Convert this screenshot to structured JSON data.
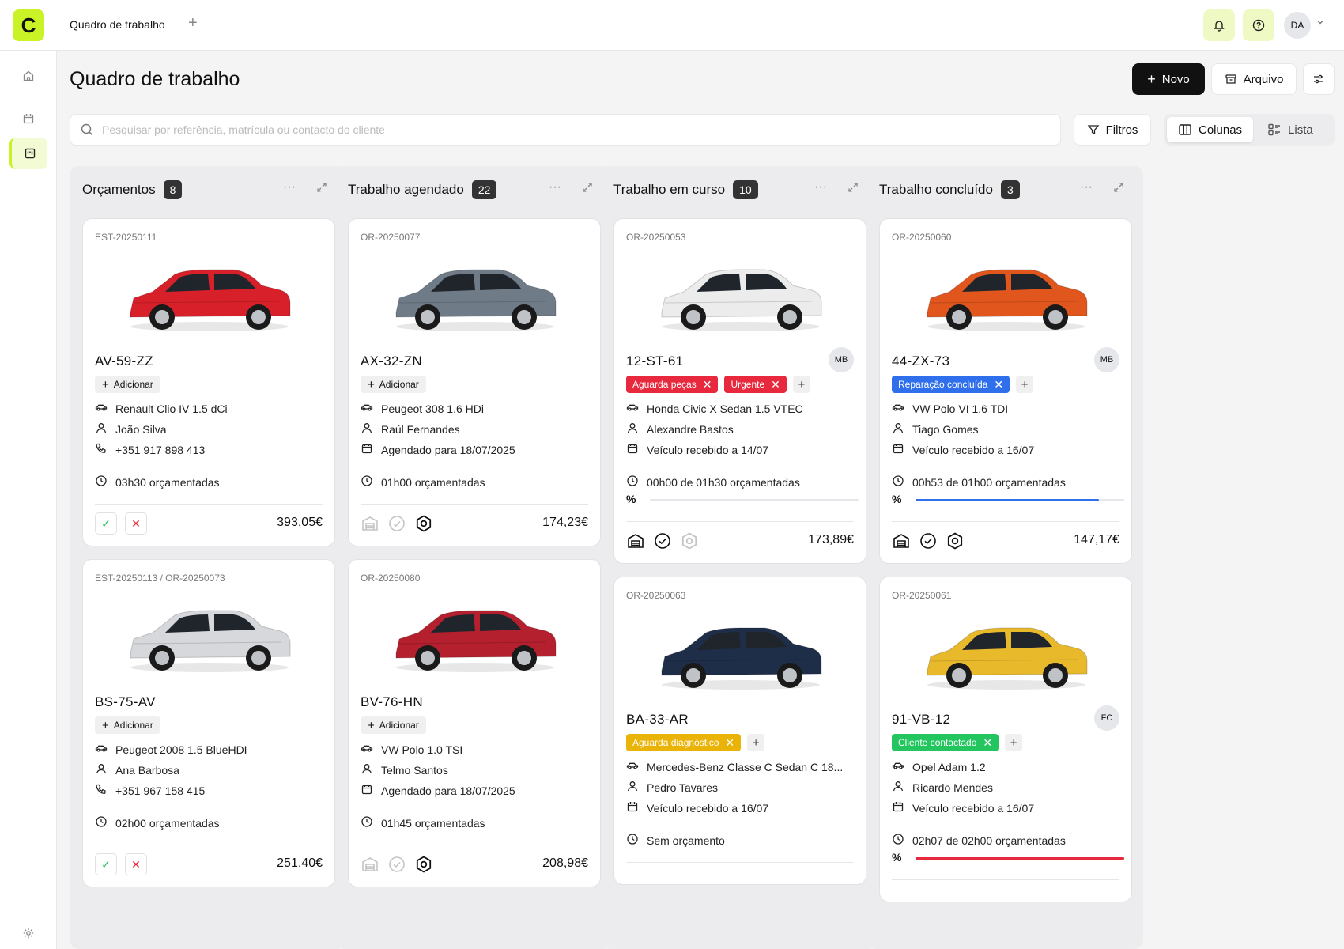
{
  "topbar": {
    "logo_letter": "C",
    "tab_label": "Quadro de trabalho",
    "avatar_initials": "DA"
  },
  "page": {
    "title": "Quadro de trabalho"
  },
  "actions": {
    "new_label": "Novo",
    "archive_label": "Arquivo"
  },
  "search": {
    "placeholder": "Pesquisar por referência, matrícula ou contacto do cliente"
  },
  "filters_label": "Filtros",
  "view": {
    "columns_label": "Colunas",
    "list_label": "Lista",
    "selected": "Colunas"
  },
  "add_label": "Adicionar",
  "columns": [
    {
      "title": "Orçamentos",
      "count": "8",
      "cards": [
        {
          "ref": "EST-20250111",
          "plate": "AV-59-ZZ",
          "car_color": "#d8202a",
          "model": "Renault Clio IV 1.5 dCi",
          "client": "João Silva",
          "contact": "+351 917 898 413",
          "time": "03h30 orçamentadas",
          "price": "393,05€"
        },
        {
          "ref": "EST-20250113 / OR-20250073",
          "plate": "BS-75-AV",
          "car_color": "#d6d8db",
          "model": "Peugeot 2008 1.5 BlueHDI",
          "client": "Ana Barbosa",
          "contact": "+351 967 158 415",
          "time": "02h00 orçamentadas",
          "price": "251,40€"
        }
      ]
    },
    {
      "title": "Trabalho agendado",
      "count": "22",
      "cards": [
        {
          "ref": "OR-20250077",
          "plate": "AX-32-ZN",
          "car_color": "#6f7b87",
          "model": "Peugeot 308 1.6 HDi",
          "client": "Raúl Fernandes",
          "date": "Agendado para 18/07/2025",
          "time": "01h00 orçamentadas",
          "price": "174,23€"
        },
        {
          "ref": "OR-20250080",
          "plate": "BV-76-HN",
          "car_color": "#b4202e",
          "model": "VW Polo 1.0 TSI",
          "client": "Telmo Santos",
          "date": "Agendado para 18/07/2025",
          "time": "01h45 orçamentadas",
          "price": "208,98€"
        }
      ]
    },
    {
      "title": "Trabalho em curso",
      "count": "10",
      "cards": [
        {
          "ref": "OR-20250053",
          "plate": "12-ST-61",
          "initials": "MB",
          "car_color": "#ececec",
          "tags": [
            {
              "label": "Aguarda peças",
              "color": "#e8283c"
            },
            {
              "label": "Urgente",
              "color": "#e8283c"
            }
          ],
          "model": "Honda Civic X Sedan 1.5 VTEC",
          "client": "Alexandre Bastos",
          "date": "Veículo recebido a 14/07",
          "time": "00h00 de 01h30 orçamentadas",
          "progress": 0,
          "price": "173,89€"
        },
        {
          "ref": "OR-20250063",
          "plate": "BA-33-AR",
          "car_color": "#1e2e48",
          "tags": [
            {
              "label": "Aguarda diagnóstico",
              "color": "#eab308"
            }
          ],
          "model": "Mercedes-Benz Classe C Sedan C 18...",
          "client": "Pedro Tavares",
          "date": "Veículo recebido a 16/07",
          "time": "Sem orçamento"
        }
      ]
    },
    {
      "title": "Trabalho concluído",
      "count": "3",
      "cards": [
        {
          "ref": "OR-20250060",
          "plate": "44-ZX-73",
          "initials": "MB",
          "car_color": "#e0561d",
          "tags": [
            {
              "label": "Reparação concluída",
              "color": "#2f6fec"
            }
          ],
          "model": "VW Polo VI 1.6 TDI",
          "client": "Tiago Gomes",
          "date": "Veículo recebido a 16/07",
          "time": "00h53 de 01h00 orçamentadas",
          "progress": 0.88,
          "progress_color": "#2f6fec",
          "price": "147,17€"
        },
        {
          "ref": "OR-20250061",
          "plate": "91-VB-12",
          "initials": "FC",
          "car_color": "#e9b92c",
          "tags": [
            {
              "label": "Cliente contactado",
              "color": "#22c55e"
            }
          ],
          "model": "Opel Adam 1.2",
          "client": "Ricardo Mendes",
          "date": "Veículo recebido a 16/07",
          "time": "02h07 de 02h00 orçamentadas",
          "progress": 1,
          "progress_color": "#e8283c"
        }
      ]
    }
  ]
}
